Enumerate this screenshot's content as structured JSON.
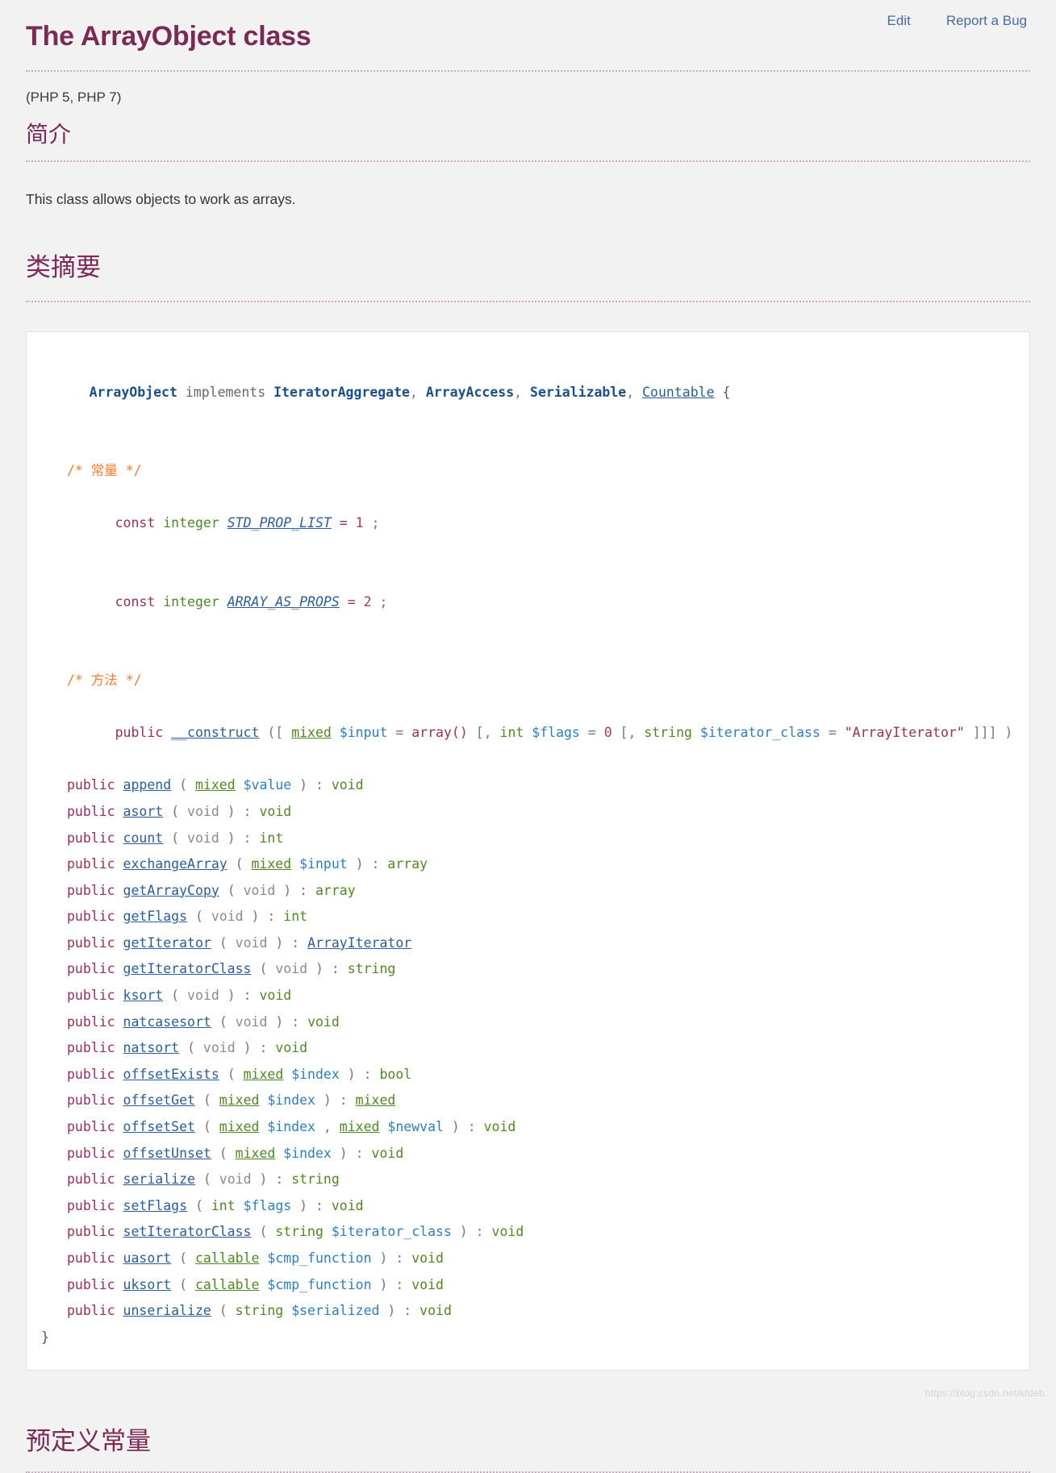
{
  "toplinks": [
    {
      "label": "Edit"
    },
    {
      "label": "Report a Bug"
    }
  ],
  "page": {
    "title": "The ArrayObject class",
    "version": "(PHP 5, PHP 7)",
    "intro_heading": "简介",
    "intro_text": "This class allows objects to work as arrays.",
    "synopsis_heading": "类摘要",
    "constants_heading": "预定义常量",
    "watermark": "https://blog.csdn.net/kfdeb"
  },
  "colors": {
    "heading": "#7a2a55",
    "link": "#4a6b9a",
    "comment": "#ff7b29",
    "modifier": "#9b2d5e",
    "type": "#4c8a1f",
    "methodname": "#2a5d9e",
    "param": "#2a7fc4",
    "string": "#a03050",
    "number": "#b03a48",
    "void": "#8a8a8a",
    "code_bg": "#ffffff",
    "page_bg": "#f2f2f2"
  },
  "synopsis": {
    "class_name": "ArrayObject",
    "implements_kw": "implements",
    "interfaces": [
      {
        "name": "IteratorAggregate",
        "link": false
      },
      {
        "name": "ArrayAccess",
        "link": false
      },
      {
        "name": "Serializable",
        "link": false
      },
      {
        "name": "Countable",
        "link": true
      }
    ],
    "open_brace": "{",
    "close_brace": "}",
    "comma": ",",
    "constants_comment": "/* 常量 */",
    "methods_comment": "/* 方法 */",
    "constants": [
      {
        "kw": "const",
        "type": "integer",
        "name": "STD_PROP_LIST",
        "op": "=",
        "value": "1",
        "semi": ";"
      },
      {
        "kw": "const",
        "type": "integer",
        "name": "ARRAY_AS_PROPS",
        "op": "=",
        "value": "2",
        "semi": ";"
      }
    ],
    "constructor": {
      "modifier": "public",
      "name": "__construct",
      "line1": [
        {
          "t": "([ ",
          "c": "punct"
        },
        {
          "t": "mixed",
          "c": "type-link"
        },
        {
          "t": " ",
          "c": "punct"
        },
        {
          "t": "$input",
          "c": "param"
        },
        {
          "t": " = ",
          "c": "punct"
        },
        {
          "t": "array()",
          "c": "arrfn"
        },
        {
          "t": " [, ",
          "c": "punct"
        },
        {
          "t": "int",
          "c": "type"
        },
        {
          "t": " ",
          "c": "punct"
        },
        {
          "t": "$flags",
          "c": "param"
        },
        {
          "t": " = ",
          "c": "punct"
        },
        {
          "t": "0",
          "c": "num"
        },
        {
          "t": " [, ",
          "c": "punct"
        },
        {
          "t": "string",
          "c": "type"
        },
        {
          "t": " ",
          "c": "punct"
        },
        {
          "t": "$iterator_class",
          "c": "param"
        },
        {
          "t": " = ",
          "c": "punct"
        }
      ],
      "line2": [
        {
          "t": "\"ArrayIterator\"",
          "c": "str"
        },
        {
          "t": " ]]] )",
          "c": "punct"
        }
      ]
    },
    "methods": [
      {
        "modifier": "public",
        "name": "append",
        "params": [
          {
            "t": "( ",
            "c": "punct"
          },
          {
            "t": "mixed",
            "c": "type-link"
          },
          {
            "t": " ",
            "c": "punct"
          },
          {
            "t": "$value",
            "c": "param"
          },
          {
            "t": " ) : ",
            "c": "punct"
          }
        ],
        "ret": {
          "t": "void",
          "c": "rettype"
        }
      },
      {
        "modifier": "public",
        "name": "asort",
        "params": [
          {
            "t": "( ",
            "c": "punct"
          },
          {
            "t": "void",
            "c": "void"
          },
          {
            "t": " ) : ",
            "c": "punct"
          }
        ],
        "ret": {
          "t": "void",
          "c": "rettype"
        }
      },
      {
        "modifier": "public",
        "name": "count",
        "params": [
          {
            "t": "( ",
            "c": "punct"
          },
          {
            "t": "void",
            "c": "void"
          },
          {
            "t": " ) : ",
            "c": "punct"
          }
        ],
        "ret": {
          "t": "int",
          "c": "rettype"
        }
      },
      {
        "modifier": "public",
        "name": "exchangeArray",
        "params": [
          {
            "t": "( ",
            "c": "punct"
          },
          {
            "t": "mixed",
            "c": "type-link"
          },
          {
            "t": " ",
            "c": "punct"
          },
          {
            "t": "$input",
            "c": "param"
          },
          {
            "t": " ) : ",
            "c": "punct"
          }
        ],
        "ret": {
          "t": "array",
          "c": "rettype"
        }
      },
      {
        "modifier": "public",
        "name": "getArrayCopy",
        "params": [
          {
            "t": "( ",
            "c": "punct"
          },
          {
            "t": "void",
            "c": "void"
          },
          {
            "t": " ) : ",
            "c": "punct"
          }
        ],
        "ret": {
          "t": "array",
          "c": "rettype"
        }
      },
      {
        "modifier": "public",
        "name": "getFlags",
        "params": [
          {
            "t": "( ",
            "c": "punct"
          },
          {
            "t": "void",
            "c": "void"
          },
          {
            "t": " ) : ",
            "c": "punct"
          }
        ],
        "ret": {
          "t": "int",
          "c": "rettype"
        }
      },
      {
        "modifier": "public",
        "name": "getIterator",
        "params": [
          {
            "t": "( ",
            "c": "punct"
          },
          {
            "t": "void",
            "c": "void"
          },
          {
            "t": " ) : ",
            "c": "punct"
          }
        ],
        "ret": {
          "t": "ArrayIterator",
          "c": "classret-link"
        }
      },
      {
        "modifier": "public",
        "name": "getIteratorClass",
        "params": [
          {
            "t": "( ",
            "c": "punct"
          },
          {
            "t": "void",
            "c": "void"
          },
          {
            "t": " ) : ",
            "c": "punct"
          }
        ],
        "ret": {
          "t": "string",
          "c": "rettype"
        }
      },
      {
        "modifier": "public",
        "name": "ksort",
        "params": [
          {
            "t": "( ",
            "c": "punct"
          },
          {
            "t": "void",
            "c": "void"
          },
          {
            "t": " ) : ",
            "c": "punct"
          }
        ],
        "ret": {
          "t": "void",
          "c": "rettype"
        }
      },
      {
        "modifier": "public",
        "name": "natcasesort",
        "params": [
          {
            "t": "( ",
            "c": "punct"
          },
          {
            "t": "void",
            "c": "void"
          },
          {
            "t": " ) : ",
            "c": "punct"
          }
        ],
        "ret": {
          "t": "void",
          "c": "rettype"
        }
      },
      {
        "modifier": "public",
        "name": "natsort",
        "params": [
          {
            "t": "( ",
            "c": "punct"
          },
          {
            "t": "void",
            "c": "void"
          },
          {
            "t": " ) : ",
            "c": "punct"
          }
        ],
        "ret": {
          "t": "void",
          "c": "rettype"
        }
      },
      {
        "modifier": "public",
        "name": "offsetExists",
        "params": [
          {
            "t": "( ",
            "c": "punct"
          },
          {
            "t": "mixed",
            "c": "type-link"
          },
          {
            "t": " ",
            "c": "punct"
          },
          {
            "t": "$index",
            "c": "param"
          },
          {
            "t": " ) : ",
            "c": "punct"
          }
        ],
        "ret": {
          "t": "bool",
          "c": "rettype"
        }
      },
      {
        "modifier": "public",
        "name": "offsetGet",
        "params": [
          {
            "t": "( ",
            "c": "punct"
          },
          {
            "t": "mixed",
            "c": "type-link"
          },
          {
            "t": " ",
            "c": "punct"
          },
          {
            "t": "$index",
            "c": "param"
          },
          {
            "t": " ) : ",
            "c": "punct"
          }
        ],
        "ret": {
          "t": "mixed",
          "c": "rettype-link"
        }
      },
      {
        "modifier": "public",
        "name": "offsetSet",
        "params": [
          {
            "t": "( ",
            "c": "punct"
          },
          {
            "t": "mixed",
            "c": "type-link"
          },
          {
            "t": " ",
            "c": "punct"
          },
          {
            "t": "$index",
            "c": "param"
          },
          {
            "t": " , ",
            "c": "punct"
          },
          {
            "t": "mixed",
            "c": "type-link"
          },
          {
            "t": " ",
            "c": "punct"
          },
          {
            "t": "$newval",
            "c": "param"
          },
          {
            "t": " ) : ",
            "c": "punct"
          }
        ],
        "ret": {
          "t": "void",
          "c": "rettype"
        }
      },
      {
        "modifier": "public",
        "name": "offsetUnset",
        "params": [
          {
            "t": "( ",
            "c": "punct"
          },
          {
            "t": "mixed",
            "c": "type-link"
          },
          {
            "t": " ",
            "c": "punct"
          },
          {
            "t": "$index",
            "c": "param"
          },
          {
            "t": " ) : ",
            "c": "punct"
          }
        ],
        "ret": {
          "t": "void",
          "c": "rettype"
        }
      },
      {
        "modifier": "public",
        "name": "serialize",
        "params": [
          {
            "t": "( ",
            "c": "punct"
          },
          {
            "t": "void",
            "c": "void"
          },
          {
            "t": " ) : ",
            "c": "punct"
          }
        ],
        "ret": {
          "t": "string",
          "c": "rettype"
        }
      },
      {
        "modifier": "public",
        "name": "setFlags",
        "params": [
          {
            "t": "( ",
            "c": "punct"
          },
          {
            "t": "int",
            "c": "type"
          },
          {
            "t": " ",
            "c": "punct"
          },
          {
            "t": "$flags",
            "c": "param"
          },
          {
            "t": " ) : ",
            "c": "punct"
          }
        ],
        "ret": {
          "t": "void",
          "c": "rettype"
        }
      },
      {
        "modifier": "public",
        "name": "setIteratorClass",
        "params": [
          {
            "t": "( ",
            "c": "punct"
          },
          {
            "t": "string",
            "c": "type"
          },
          {
            "t": " ",
            "c": "punct"
          },
          {
            "t": "$iterator_class",
            "c": "param"
          },
          {
            "t": " ) : ",
            "c": "punct"
          }
        ],
        "ret": {
          "t": "void",
          "c": "rettype"
        }
      },
      {
        "modifier": "public",
        "name": "uasort",
        "params": [
          {
            "t": "( ",
            "c": "punct"
          },
          {
            "t": "callable",
            "c": "type-link"
          },
          {
            "t": " ",
            "c": "punct"
          },
          {
            "t": "$cmp_function",
            "c": "param"
          },
          {
            "t": " ) : ",
            "c": "punct"
          }
        ],
        "ret": {
          "t": "void",
          "c": "rettype"
        }
      },
      {
        "modifier": "public",
        "name": "uksort",
        "params": [
          {
            "t": "( ",
            "c": "punct"
          },
          {
            "t": "callable",
            "c": "type-link"
          },
          {
            "t": " ",
            "c": "punct"
          },
          {
            "t": "$cmp_function",
            "c": "param"
          },
          {
            "t": " ) : ",
            "c": "punct"
          }
        ],
        "ret": {
          "t": "void",
          "c": "rettype"
        }
      },
      {
        "modifier": "public",
        "name": "unserialize",
        "params": [
          {
            "t": "( ",
            "c": "punct"
          },
          {
            "t": "string",
            "c": "type"
          },
          {
            "t": " ",
            "c": "punct"
          },
          {
            "t": "$serialized",
            "c": "param"
          },
          {
            "t": " ) : ",
            "c": "punct"
          }
        ],
        "ret": {
          "t": "void",
          "c": "rettype"
        }
      }
    ]
  }
}
